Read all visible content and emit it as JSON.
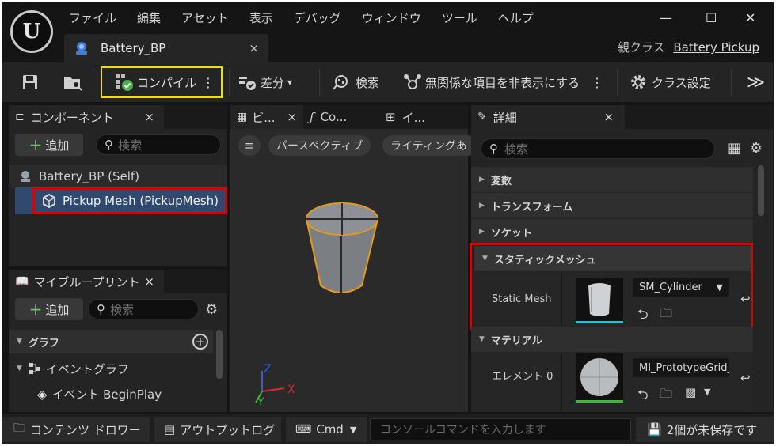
{
  "menu": [
    "ファイル",
    "編集",
    "アセット",
    "表示",
    "デバッグ",
    "ウィンドウ",
    "ツール",
    "ヘルプ"
  ],
  "tab": {
    "title": "Battery_BP",
    "close": "×"
  },
  "parent_class": {
    "label": "親クラス",
    "value": "Battery Pickup"
  },
  "window_controls": {
    "minimize": "—",
    "maximize": "☐",
    "close": "✕"
  },
  "toolbar": {
    "compile": "コンパイル",
    "diff": "差分",
    "find": "検索",
    "hide_unrelated": "無関係な項目を非表示にする",
    "class_settings": "クラス設定",
    "more": "≫"
  },
  "components": {
    "title": "コンポーネント",
    "add": "追加",
    "search_placeholder": "検索",
    "items": [
      "Battery_BP (Self)",
      "Pickup Mesh (PickupMesh)"
    ]
  },
  "my_blueprint": {
    "title": "マイブループリント",
    "add": "追加",
    "search_placeholder": "検索",
    "graph_header": "グラフ",
    "event_graph": "イベントグラフ",
    "event_begin_play": "イベント BeginPlay"
  },
  "viewport": {
    "tabs": [
      "ビ...",
      "Co...",
      "イ..."
    ],
    "menu_icon": "≡",
    "perspective": "パースペクティブ",
    "lighting": "ライティングあ",
    "axes": {
      "z": "Z",
      "x": "X",
      "y": "Y"
    }
  },
  "details": {
    "title": "詳細",
    "search_placeholder": "検索",
    "sections": [
      "変数",
      "トランスフォーム",
      "ソケット",
      "スタティックメッシュ",
      "マテリアル"
    ],
    "static_mesh_label": "Static Mesh",
    "static_mesh_value": "SM_Cylinder",
    "element_label": "エレメント 0",
    "material_value": "MI_PrototypeGrid_Gr"
  },
  "statusbar": {
    "content_drawer": "コンテンツ ドロワー",
    "output_log": "アウトプットログ",
    "cmd": "Cmd",
    "console_placeholder": "コンソールコマンドを入力します",
    "unsaved": "2個が未保存です"
  },
  "colors": {
    "highlight_red": "#e10000",
    "compile_yellow": "#f0e000",
    "selection_blue": "#2f4a6e",
    "axis_x": "#d62b2b",
    "axis_y": "#3cb83c",
    "axis_z": "#2f5fd6"
  }
}
